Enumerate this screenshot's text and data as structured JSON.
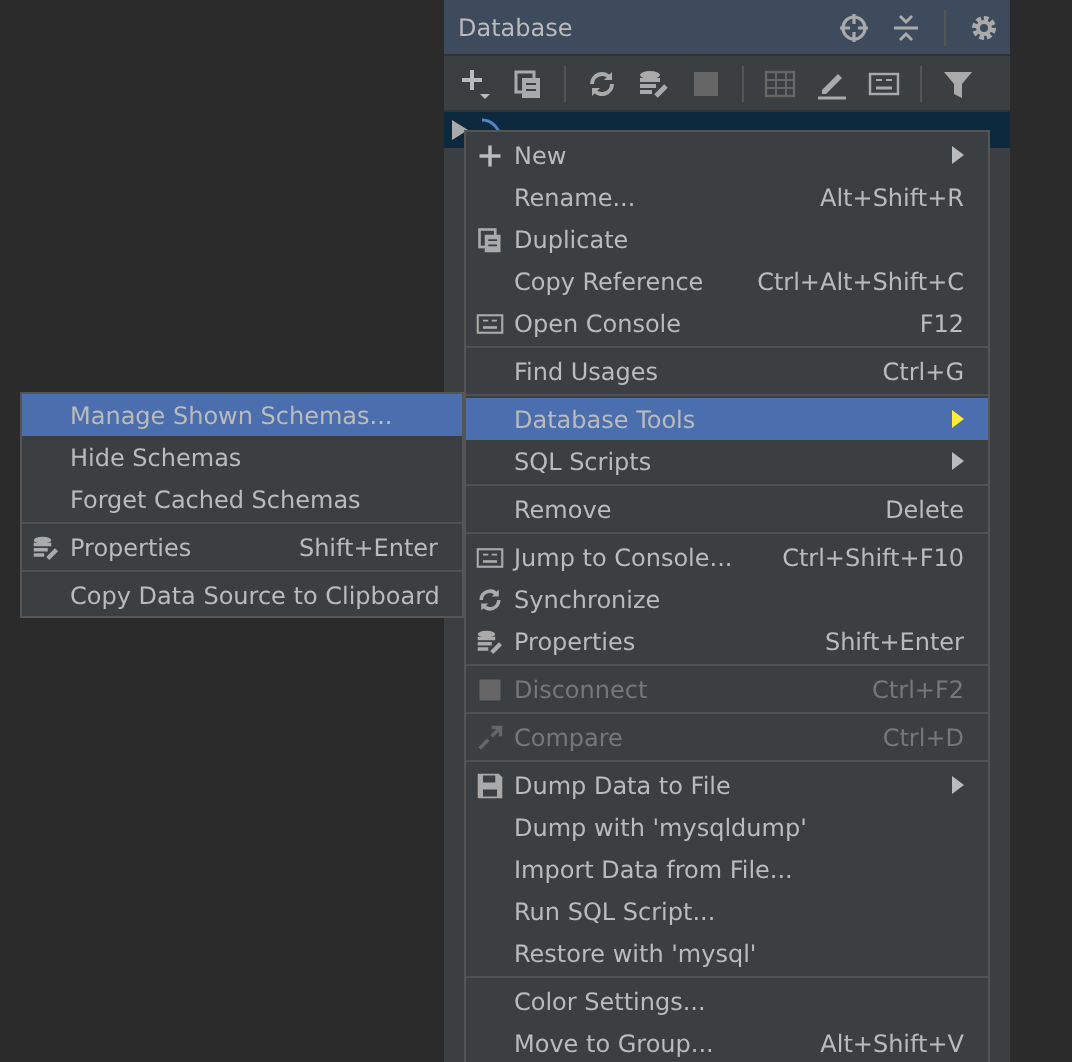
{
  "panel": {
    "title": "Database"
  },
  "tree": {
    "selected": true
  },
  "menu": [
    {
      "kind": "item",
      "label": "New",
      "submenu": true,
      "disabled": false,
      "selected": false
    },
    {
      "kind": "item",
      "label": "Rename...",
      "shortcut": "Alt+Shift+R",
      "disabled": false,
      "selected": false
    },
    {
      "kind": "item",
      "label": "Duplicate",
      "disabled": false,
      "selected": false
    },
    {
      "kind": "item",
      "label": "Copy Reference",
      "shortcut": "Ctrl+Alt+Shift+C",
      "disabled": false,
      "selected": false
    },
    {
      "kind": "item",
      "label": "Open Console",
      "shortcut": "F12",
      "disabled": false,
      "selected": false
    },
    {
      "kind": "separator"
    },
    {
      "kind": "item",
      "label": "Find Usages",
      "shortcut": "Ctrl+G",
      "disabled": false,
      "selected": false
    },
    {
      "kind": "separator"
    },
    {
      "kind": "item",
      "label": "Database Tools",
      "submenu": true,
      "disabled": false,
      "selected": true
    },
    {
      "kind": "item",
      "label": "SQL Scripts",
      "submenu": true,
      "disabled": false,
      "selected": false
    },
    {
      "kind": "separator"
    },
    {
      "kind": "item",
      "label": "Remove",
      "shortcut": "Delete",
      "disabled": false,
      "selected": false
    },
    {
      "kind": "separator"
    },
    {
      "kind": "item",
      "label": "Jump to Console...",
      "shortcut": "Ctrl+Shift+F10",
      "disabled": false,
      "selected": false
    },
    {
      "kind": "item",
      "label": "Synchronize",
      "disabled": false,
      "selected": false
    },
    {
      "kind": "item",
      "label": "Properties",
      "shortcut": "Shift+Enter",
      "disabled": false,
      "selected": false
    },
    {
      "kind": "separator"
    },
    {
      "kind": "item",
      "label": "Disconnect",
      "shortcut": "Ctrl+F2",
      "disabled": true,
      "selected": false
    },
    {
      "kind": "separator"
    },
    {
      "kind": "item",
      "label": "Compare",
      "shortcut": "Ctrl+D",
      "disabled": true,
      "selected": false
    },
    {
      "kind": "separator"
    },
    {
      "kind": "item",
      "label": "Dump Data to File",
      "submenu": true,
      "disabled": false,
      "selected": false
    },
    {
      "kind": "item",
      "label": "Dump with 'mysqldump'",
      "disabled": false,
      "selected": false
    },
    {
      "kind": "item",
      "label": "Import Data from File...",
      "disabled": false,
      "selected": false
    },
    {
      "kind": "item",
      "label": "Run SQL Script...",
      "disabled": false,
      "selected": false
    },
    {
      "kind": "item",
      "label": "Restore with 'mysql'",
      "disabled": false,
      "selected": false
    },
    {
      "kind": "separator"
    },
    {
      "kind": "item",
      "label": "Color Settings...",
      "disabled": false,
      "selected": false
    },
    {
      "kind": "item",
      "label": "Move to Group...",
      "shortcut": "Alt+Shift+V",
      "disabled": false,
      "selected": false
    }
  ],
  "submenu": [
    {
      "kind": "item",
      "label": "Manage Shown Schemas...",
      "disabled": false,
      "selected": true
    },
    {
      "kind": "item",
      "label": "Hide Schemas",
      "disabled": false,
      "selected": false
    },
    {
      "kind": "item",
      "label": "Forget Cached Schemas",
      "disabled": false,
      "selected": false
    },
    {
      "kind": "separator"
    },
    {
      "kind": "item",
      "label": "Properties",
      "shortcut": "Shift+Enter",
      "disabled": false,
      "selected": false
    },
    {
      "kind": "separator"
    },
    {
      "kind": "item",
      "label": "Copy Data Source to Clipboard",
      "disabled": false,
      "selected": false
    }
  ]
}
